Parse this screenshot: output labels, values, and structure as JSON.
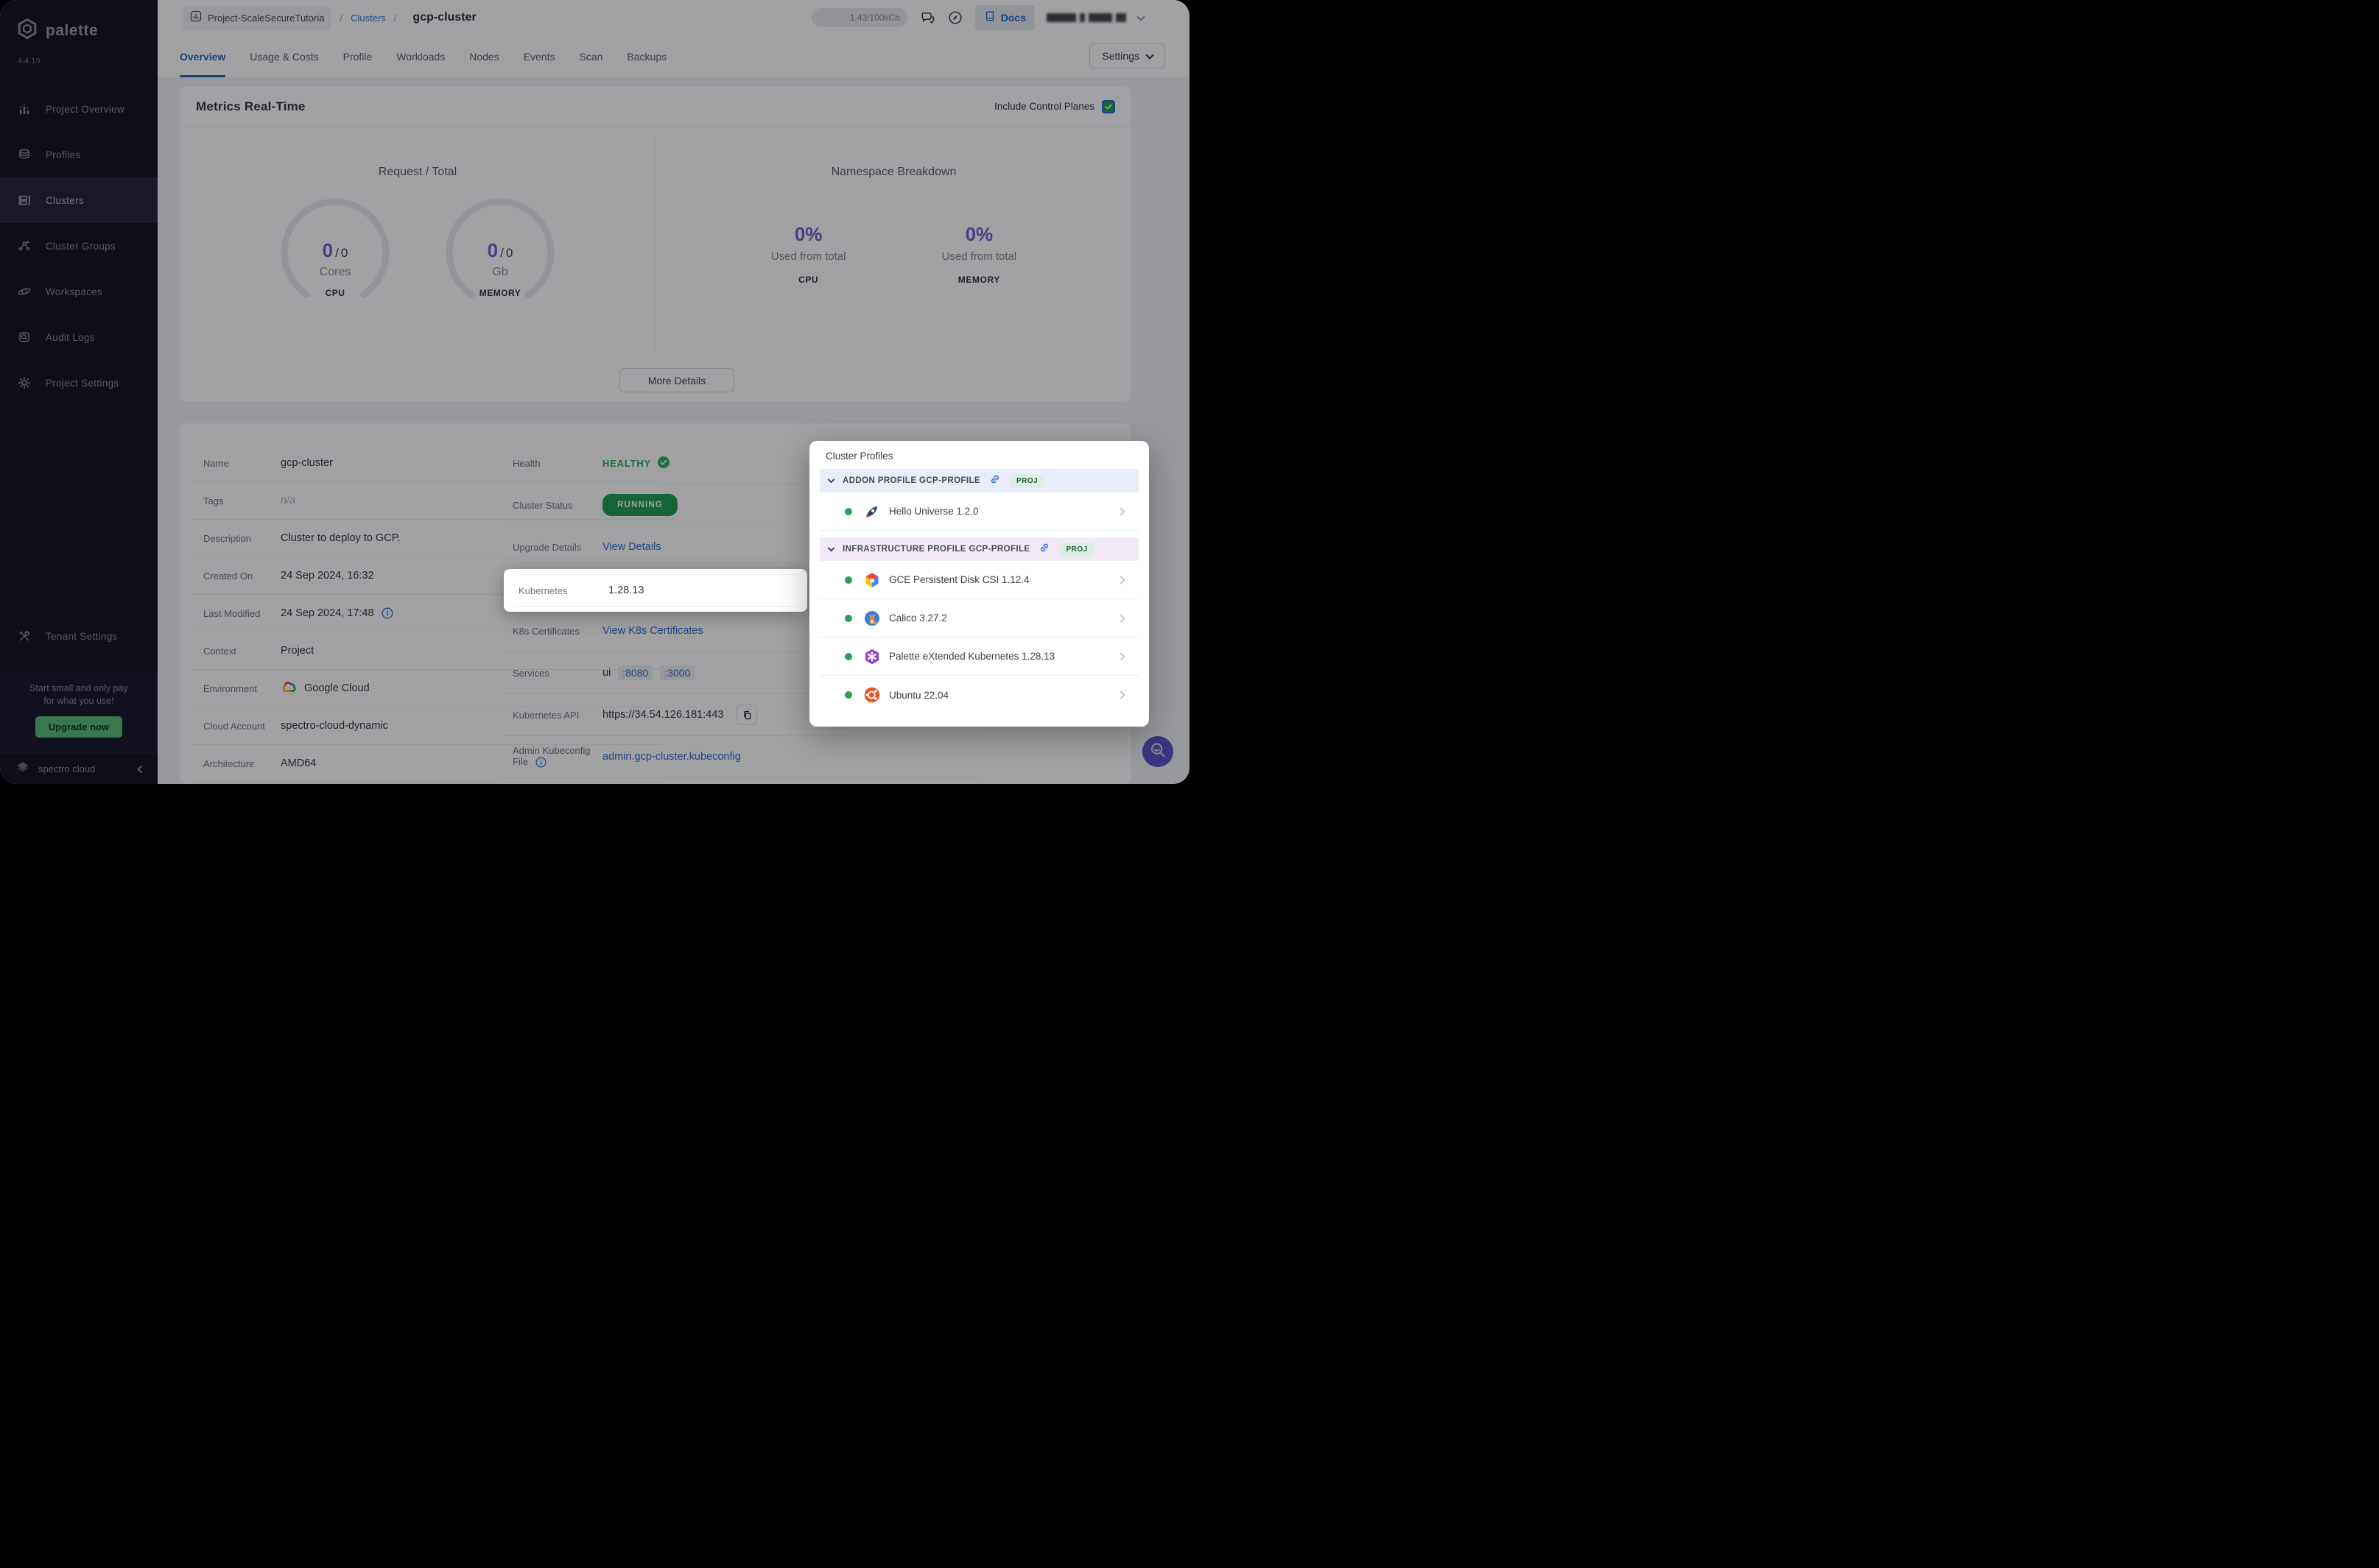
{
  "sidebar": {
    "brand": "palette",
    "version": "4.4.19",
    "items": [
      {
        "label": "Project Overview",
        "icon": "bar-chart"
      },
      {
        "label": "Profiles",
        "icon": "layers"
      },
      {
        "label": "Clusters",
        "icon": "server",
        "active": true
      },
      {
        "label": "Cluster Groups",
        "icon": "network"
      },
      {
        "label": "Workspaces",
        "icon": "orbit"
      },
      {
        "label": "Audit Logs",
        "icon": "audit"
      },
      {
        "label": "Project Settings",
        "icon": "gear"
      }
    ],
    "tenant_settings": "Tenant Settings",
    "promo": {
      "line1": "Start small and only pay",
      "line2": "for what you use!",
      "cta": "Upgrade now"
    },
    "footer_brand": "spectro cloud"
  },
  "header": {
    "project": "Project-ScaleSecureTutoria",
    "separator": "/",
    "section_link": "Clusters",
    "title": "gcp-cluster",
    "credits": "1.43/100kCh",
    "docs": "Docs"
  },
  "tabs": {
    "items": [
      "Overview",
      "Usage & Costs",
      "Profile",
      "Workloads",
      "Nodes",
      "Events",
      "Scan",
      "Backups"
    ],
    "active": "Overview",
    "settings": "Settings"
  },
  "metrics": {
    "title": "Metrics Real-Time",
    "include_control_planes": "Include Control Planes",
    "request_total": {
      "title": "Request / Total",
      "separator": "/",
      "gauges": [
        {
          "value": "0",
          "total": "0",
          "unit": "Cores",
          "metric": "CPU"
        },
        {
          "value": "0",
          "total": "0",
          "unit": "Gb",
          "metric": "MEMORY"
        }
      ]
    },
    "namespace": {
      "title": "Namespace Breakdown",
      "stats": [
        {
          "percent": "0%",
          "caption": "Used from total",
          "metric": "CPU"
        },
        {
          "percent": "0%",
          "caption": "Used from total",
          "metric": "MEMORY"
        }
      ]
    },
    "more_details": "More Details"
  },
  "details": {
    "left": [
      {
        "label": "Name",
        "value": "gcp-cluster"
      },
      {
        "label": "Tags",
        "value": "n/a"
      },
      {
        "label": "Description",
        "value": "Cluster to deploy to GCP."
      },
      {
        "label": "Created On",
        "value": "24 Sep 2024, 16:32"
      },
      {
        "label": "Last Modified",
        "value": "24 Sep 2024, 17:48"
      },
      {
        "label": "Context",
        "value": "Project"
      },
      {
        "label": "Environment",
        "value": "Google Cloud"
      },
      {
        "label": "Cloud Account",
        "value": "spectro-cloud-dynamic"
      },
      {
        "label": "Architecture",
        "value": "AMD64"
      }
    ],
    "right": {
      "health": {
        "label": "Health",
        "value": "HEALTHY"
      },
      "status": {
        "label": "Cluster Status",
        "value": "RUNNING"
      },
      "upgrade": {
        "label": "Upgrade Details",
        "value": "View Details"
      },
      "kubernetes": {
        "label": "Kubernetes",
        "value": "1.28.13"
      },
      "certs": {
        "label": "K8s Certificates",
        "value": "View K8s Certificates"
      },
      "services": {
        "label": "Services",
        "value": "ui",
        "ports": [
          ":8080",
          ":3000"
        ]
      },
      "api": {
        "label": "Kubernetes API",
        "value": "https://34.54.126.181:443"
      },
      "kubeconfig": {
        "label": "Admin Kubeconfig File",
        "value": "admin.gcp-cluster.kubeconfig"
      }
    }
  },
  "cluster_profiles": {
    "title": "Cluster Profiles",
    "sections": [
      {
        "header": "ADDON PROFILE GCP-PROFILE",
        "badge": "PROJ",
        "items": [
          {
            "name": "Hello Universe 1.2.0",
            "icon": "rocket",
            "status_color": "#28a155"
          }
        ]
      },
      {
        "header": "INFRASTRUCTURE PROFILE GCP-PROFILE",
        "badge": "PROJ",
        "items": [
          {
            "name": "GCE Persistent Disk CSI 1.12.4",
            "icon": "gce-hexagon",
            "status_color": "#28a155"
          },
          {
            "name": "Calico 3.27.2",
            "icon": "calico-cat",
            "status_color": "#28a155"
          },
          {
            "name": "Palette eXtended Kubernetes 1.28.13",
            "icon": "pxk-hexagon",
            "status_color": "#28a155"
          },
          {
            "name": "Ubuntu 22.04",
            "icon": "ubuntu",
            "status_color": "#28a155"
          }
        ]
      }
    ]
  },
  "colors": {
    "accent_blue": "#2f6fd0",
    "stat_purple": "#6b63cf",
    "healthy_green": "#27ae60",
    "running_badge": "#1e9b52",
    "sidebar_bg": "#141120"
  }
}
